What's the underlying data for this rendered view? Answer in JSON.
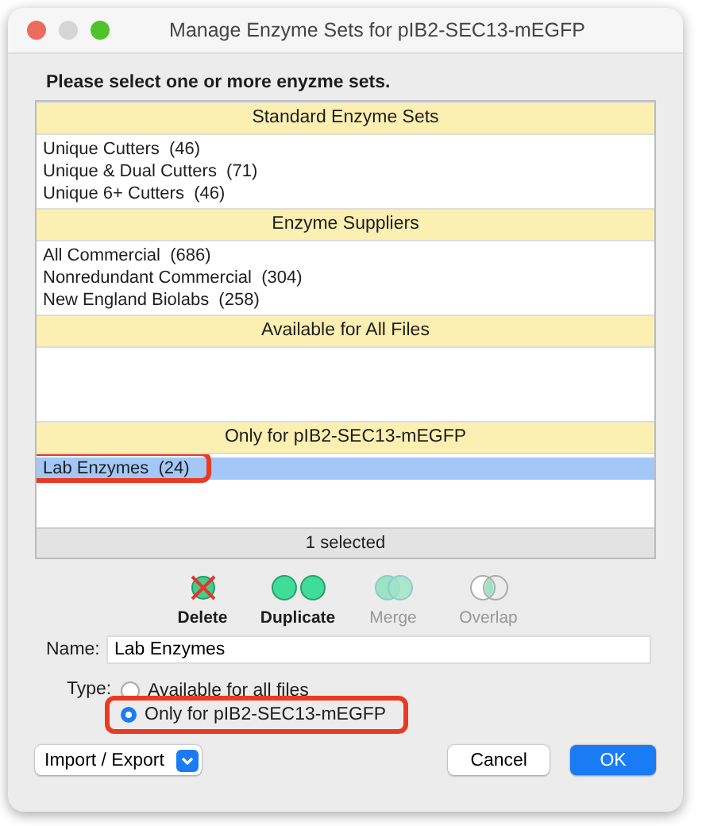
{
  "window": {
    "title": "Manage Enzyme Sets for pIB2-SEC13-mEGFP"
  },
  "prompt": "Please select one or more enyzme sets.",
  "sections": [
    {
      "title": "Standard Enzyme Sets",
      "items": [
        {
          "label": "Unique Cutters  (46)",
          "selected": false
        },
        {
          "label": "Unique & Dual Cutters  (71)",
          "selected": false
        },
        {
          "label": "Unique 6+ Cutters  (46)",
          "selected": false
        }
      ]
    },
    {
      "title": "Enzyme Suppliers",
      "items": [
        {
          "label": "All Commercial  (686)",
          "selected": false
        },
        {
          "label": "Nonredundant Commercial  (304)",
          "selected": false
        },
        {
          "label": "New England Biolabs  (258)",
          "selected": false
        }
      ]
    },
    {
      "title": "Available for All Files"
    },
    {
      "title": "Only for pIB2-SEC13-mEGFP",
      "items": [
        {
          "label": "Lab Enzymes  (24)",
          "selected": true
        }
      ]
    }
  ],
  "status": "1 selected",
  "tools": [
    {
      "kind": "delete",
      "label": "Delete",
      "disabled": false
    },
    {
      "kind": "duplicate",
      "label": "Duplicate",
      "disabled": false
    },
    {
      "kind": "merge",
      "label": "Merge",
      "disabled": true
    },
    {
      "kind": "overlap",
      "label": "Overlap",
      "disabled": true
    }
  ],
  "name": {
    "label": "Name:",
    "value": "Lab Enzymes"
  },
  "type": {
    "label": "Type:",
    "options": [
      {
        "label": "Available for all files",
        "selected": false
      },
      {
        "label": "Only for pIB2-SEC13-mEGFP",
        "selected": true
      }
    ]
  },
  "buttons": {
    "menu": "Import / Export",
    "cancel": "Cancel",
    "ok": "OK"
  }
}
